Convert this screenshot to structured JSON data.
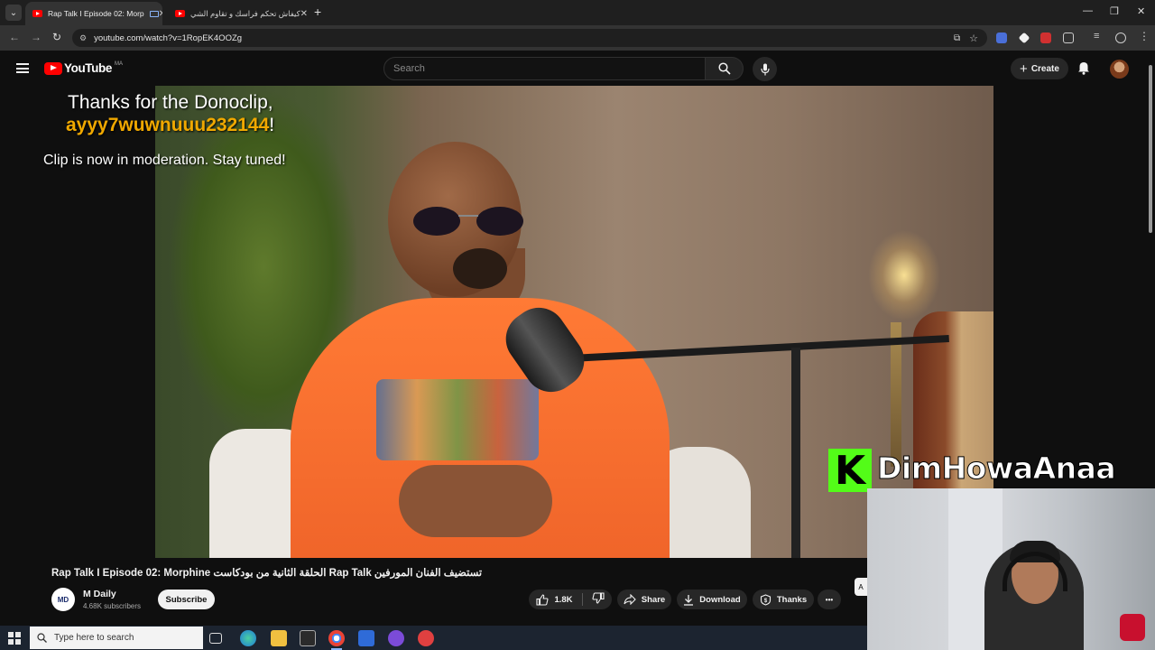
{
  "browser": {
    "tabs": [
      {
        "title": "Rap Talk I Episode 02: Morp",
        "active": true
      },
      {
        "title": "كيفاش تحكم فراسك و تقاوم الشي",
        "active": false
      }
    ],
    "new_tab_symbol": "+",
    "window_controls": {
      "minimize": "—",
      "maximize": "❐",
      "close": "✕"
    },
    "url": "youtube.com/watch?v=1RopEK4OOZg"
  },
  "youtube": {
    "logo_text": "YouTube",
    "country_code": "MA",
    "search_placeholder": "Search",
    "create_label": "Create"
  },
  "overlay": {
    "donation_line1": "Thanks for the Donoclip,",
    "donation_name": "ayyy7wuwnuuu232144",
    "donation_bang": "!",
    "moderation_text": "Clip is now in moderation. Stay tuned!",
    "kick_badge": "K",
    "kick_username": "DimHowaAnaa"
  },
  "video": {
    "title": "Rap Talk I Episode 02: Morphine الحلقة الثانية من بودكاست Rap Talk تستضيف الفنان المورفين",
    "channel_name": "M Daily",
    "channel_avatar_text": "MD",
    "subscribers": "4.68K subscribers",
    "subscribe_label": "Subscribe",
    "likes": "1.8K",
    "share_label": "Share",
    "download_label": "Download",
    "thanks_label": "Thanks",
    "more_label": "•••",
    "edge_button_label": "A"
  },
  "taskbar": {
    "search_placeholder": "Type here to search"
  },
  "colors": {
    "accent_red": "#ff0000",
    "kick_green": "#53fc18",
    "donor_name": "#f0a800"
  }
}
